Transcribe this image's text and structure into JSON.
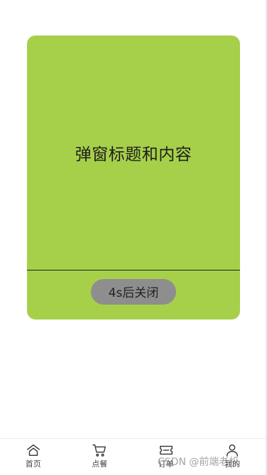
{
  "modal": {
    "content": "弹窗标题和内容",
    "close_button_label": "4s后关闭",
    "background_color": "#a6d04a",
    "button_color": "#8e8e8e"
  },
  "tabbar": {
    "items": [
      {
        "label": "首页",
        "icon": "home-icon"
      },
      {
        "label": "点餐",
        "icon": "cart-icon"
      },
      {
        "label": "订单",
        "icon": "ticket-icon"
      },
      {
        "label": "我的",
        "icon": "user-icon"
      }
    ]
  },
  "watermark": "CSDN @前端老机"
}
